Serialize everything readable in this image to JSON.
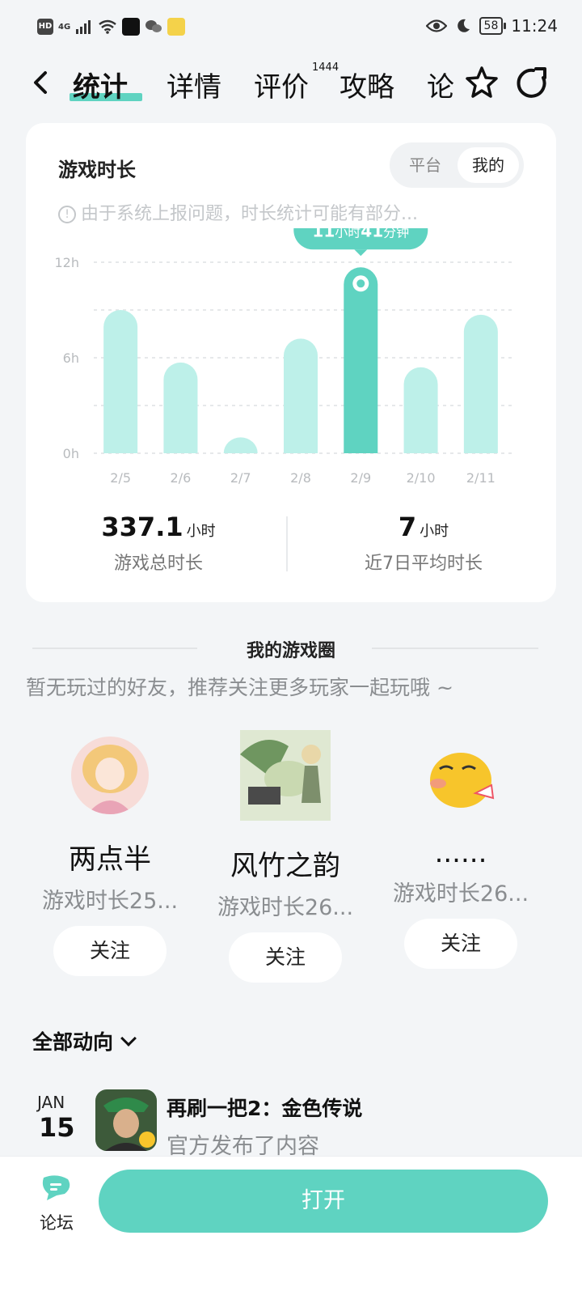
{
  "status_bar": {
    "left_badges": [
      "HD",
      "4G"
    ],
    "battery": "58",
    "time": "11:24"
  },
  "nav": {
    "back_icon": "chevron-left-icon",
    "tabs": [
      {
        "label": "统计",
        "active": true
      },
      {
        "label": "详情"
      },
      {
        "label": "评价",
        "badge": "1444"
      },
      {
        "label": "攻略"
      },
      {
        "label": "论"
      }
    ]
  },
  "stats_card": {
    "title": "游戏时长",
    "toggle": {
      "options": [
        "平台",
        "我的"
      ],
      "selected": "我的"
    },
    "notice": "由于系统上报问题，时长统计可能有部分...",
    "totals": [
      {
        "value": "337.1",
        "unit": "小时",
        "label": "游戏总时长"
      },
      {
        "value": "7",
        "unit": "小时",
        "label": "近7日平均时长"
      }
    ]
  },
  "chart_data": {
    "type": "bar",
    "categories": [
      "2/5",
      "2/6",
      "2/7",
      "2/8",
      "2/9",
      "2/10",
      "2/11"
    ],
    "values": [
      9.0,
      5.7,
      1.0,
      7.2,
      11.68,
      5.4,
      8.7
    ],
    "y_ticks": [
      "0h",
      "6h",
      "12h"
    ],
    "ylim": [
      0,
      12
    ],
    "highlight_index": 4,
    "tooltip": {
      "hours": "11",
      "hours_unit": "小时",
      "minutes": "41",
      "minutes_unit": "分钟"
    },
    "colors": {
      "bar": "#bdf0e9",
      "highlight": "#5fd3c1",
      "grid": "#e6e8ea",
      "axis_text": "#b8bbbe"
    }
  },
  "game_circle": {
    "title": "我的游戏圈",
    "subtitle": "暂无玩过的好友，推荐关注更多玩家一起玩哦 ~",
    "friends": [
      {
        "name": "两点半",
        "meta": "游戏时长25...",
        "button": "关注"
      },
      {
        "name": "风竹之韵",
        "meta": "游戏时长26...",
        "button": "关注"
      },
      {
        "name": "......",
        "meta": "游戏时长26...",
        "button": "关注"
      }
    ]
  },
  "activity": {
    "filter_label": "全部动向",
    "items": [
      {
        "month": "JAN",
        "day": "15",
        "title": "再刷一把2：金色传说",
        "subtitle": "官方发布了内容"
      }
    ]
  },
  "bottom_bar": {
    "forum_label": "论坛",
    "open_label": "打开"
  },
  "colors": {
    "accent": "#5fd3c1",
    "page_bg": "#f3f5f7"
  }
}
